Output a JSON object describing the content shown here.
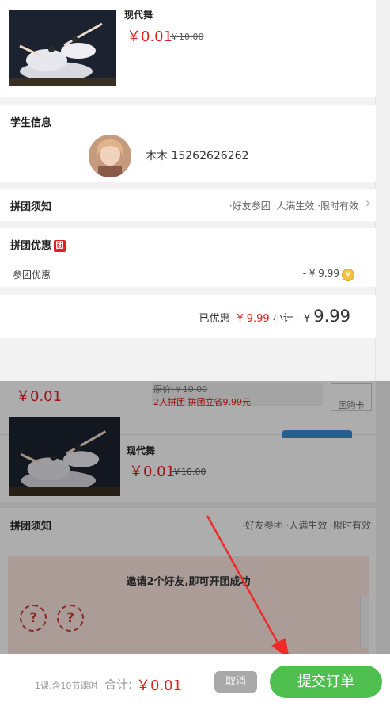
{
  "course": {
    "name": "现代舞",
    "price": "￥0.01",
    "old_price": "￥10.00"
  },
  "student": {
    "section_title": "学生信息",
    "name_phone": "木木 15262626262"
  },
  "group_notice": {
    "title": "拼团须知",
    "tags": "·好友参团 ·人满生效 ·限时有效",
    "chevron": "›"
  },
  "group_discount": {
    "title": "拼团优惠",
    "tag": "团",
    "row_label": "参团优惠",
    "row_value": "- ¥ 9.99"
  },
  "summary": {
    "discount_label": "已优惠-",
    "discount_value": "¥ 9.99",
    "subtotal_label": "小计 - ¥",
    "subtotal_value": "9.99"
  },
  "popup": {
    "price": "￥0.01",
    "price_line1": "原价:￥10.00",
    "price_line2": "2人拼团 拼团立省9.99元",
    "card_label": "团购卡",
    "course_name": "现代舞",
    "course_price": "￥0.01",
    "course_old_price": "￥10.00",
    "notice_title": "拼团须知",
    "notice_tags": "·好友参团 ·人满生效 ·限时有效",
    "invite_text": "邀请2个好友,即可开团成功",
    "placeholder_mark": "?"
  },
  "bottom": {
    "lessons": "1课,含10节课时",
    "total_label": "合计:",
    "total_value": "￥0.01",
    "cancel_label": "取消",
    "submit_label": "提交订单"
  },
  "colors": {
    "accent_red": "#e02020",
    "submit_green": "#4fc04f",
    "cancel_gray": "#a9a9a9"
  }
}
